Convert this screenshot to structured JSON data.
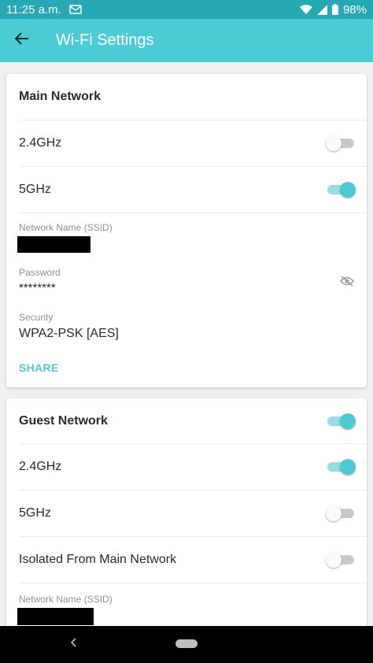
{
  "status_bar": {
    "time": "11:25 a.m.",
    "battery": "98%",
    "icons": [
      "notification-icon",
      "wifi-icon",
      "signal-icon",
      "battery-icon"
    ]
  },
  "app_bar": {
    "title": "Wi‑Fi Settings",
    "back_icon": "arrow-back-icon"
  },
  "main_network": {
    "header": "Main Network",
    "band_24": {
      "label": "2.4GHz",
      "enabled": false
    },
    "band_5": {
      "label": "5GHz",
      "enabled": true
    },
    "ssid_label": "Network Name (SSID)",
    "password_label": "Password",
    "password_value": "********",
    "password_icon": "eye-off-icon",
    "security_label": "Security",
    "security_value": "WPA2-PSK [AES]",
    "share_label": "SHARE"
  },
  "guest_network": {
    "header": "Guest Network",
    "enabled": true,
    "band_24": {
      "label": "2.4GHz",
      "enabled": true
    },
    "band_5": {
      "label": "5GHz",
      "enabled": false
    },
    "isolated": {
      "label": "Isolated From Main Network",
      "enabled": false
    },
    "ssid_label": "Network Name (SSID)"
  },
  "colors": {
    "accent": "#4ccbd5",
    "status_bar": "#26a8b5",
    "toggle_track_on": "#95dde3",
    "toggle_track_off": "#c9c9c9"
  }
}
